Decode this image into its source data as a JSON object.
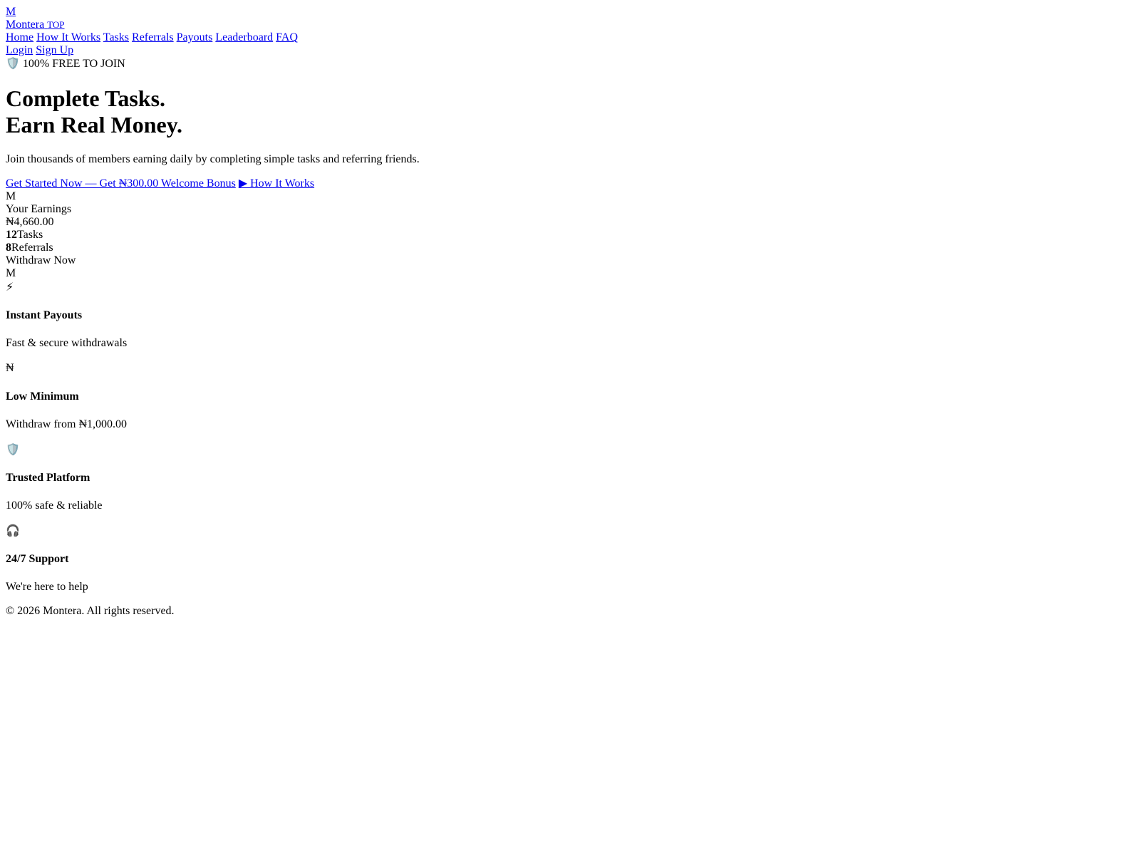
{
  "header": {
    "logo_letter": "M",
    "brand_name": "Montera",
    "brand_tag": "TOP",
    "nav": [
      "Home",
      "How It Works",
      "Tasks",
      "Referrals",
      "Payouts",
      "Leaderboard",
      "FAQ"
    ],
    "auth": {
      "login": "Login",
      "signup": "Sign Up"
    }
  },
  "hero": {
    "badge_icon": "🛡️",
    "badge_text": "100% FREE TO JOIN",
    "title_line1": "Complete Tasks.",
    "title_line2": "Earn Real Money.",
    "subtitle": "Join thousands of members earning daily by completing simple tasks and referring friends.",
    "cta_primary": "Get Started Now — Get ₦300.00 Welcome Bonus",
    "cta_secondary": "▶ How It Works"
  },
  "earnings_card": {
    "avatar_letter": "M",
    "label": "Your Earnings",
    "amount": "₦4,660.00",
    "tasks_count": "12",
    "tasks_label": "Tasks",
    "referrals_count": "8",
    "referrals_label": "Referrals",
    "withdraw_label": "Withdraw Now",
    "avatar2_letter": "M"
  },
  "features": [
    {
      "icon": "⚡",
      "icon_name": "lightning-icon",
      "title": "Instant Payouts",
      "desc": "Fast & secure withdrawals"
    },
    {
      "icon": "₦",
      "icon_name": "naira-icon",
      "title": "Low Minimum",
      "desc": "Withdraw from ₦1,000.00"
    },
    {
      "icon": "🛡️",
      "icon_name": "shield-icon",
      "title": "Trusted Platform",
      "desc": "100% safe & reliable"
    },
    {
      "icon": "🎧",
      "icon_name": "headphones-icon",
      "title": "24/7 Support",
      "desc": "We're here to help"
    }
  ],
  "footer": {
    "copyright": "© 2026 Montera. All rights reserved."
  }
}
